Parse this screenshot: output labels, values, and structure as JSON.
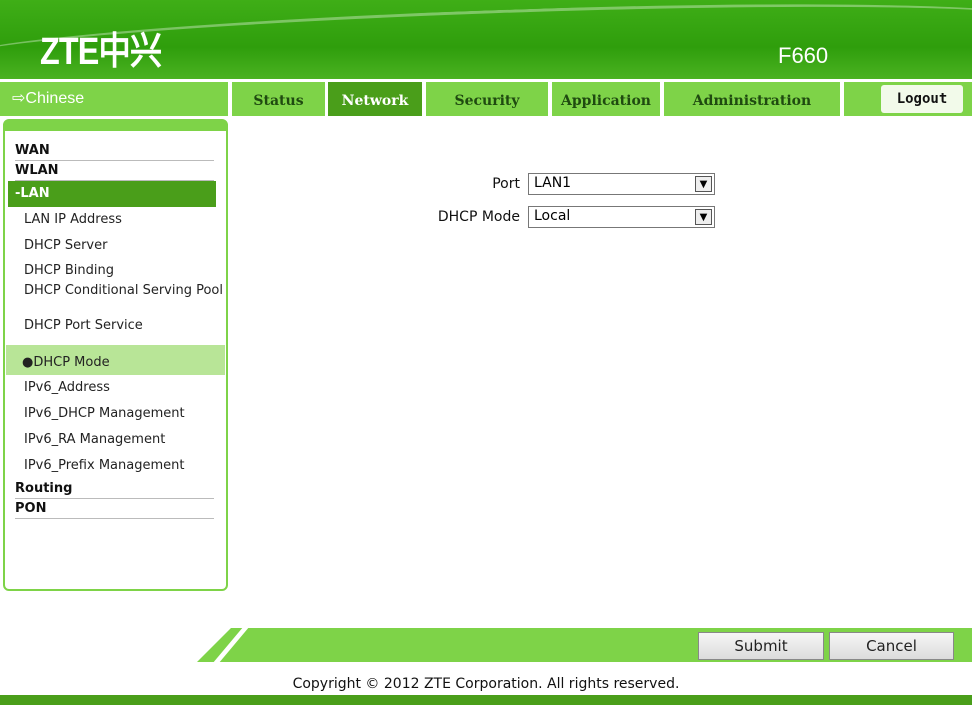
{
  "header": {
    "logo": "ZTE中兴",
    "model": "F660"
  },
  "nav": {
    "language": "⇨Chinese",
    "tabs": [
      "Status",
      "Network",
      "Security",
      "Application",
      "Administration"
    ],
    "active_tab": "Network",
    "logout": "Logout"
  },
  "sidebar": {
    "items": [
      "WAN",
      "WLAN",
      "-LAN",
      "Routing",
      "PON"
    ],
    "lan_sub": [
      "LAN IP Address",
      "DHCP Server",
      "DHCP Binding",
      "DHCP Conditional Serving Pool",
      "DHCP Port Service",
      "●DHCP Mode",
      "IPv6_Address",
      "IPv6_DHCP Management",
      "IPv6_RA Management",
      "IPv6_Prefix Management"
    ],
    "selected": "DHCP Mode"
  },
  "form": {
    "port_label": "Port",
    "port_value": "LAN1",
    "mode_label": "DHCP Mode",
    "mode_value": "Local"
  },
  "buttons": {
    "submit": "Submit",
    "cancel": "Cancel"
  },
  "footer": {
    "copyright": "Copyright © 2012 ZTE Corporation. All rights reserved."
  },
  "colors": {
    "brand_green": "#7ed348",
    "dark_green": "#4a9e1a",
    "selected_bg": "#b8e597"
  }
}
